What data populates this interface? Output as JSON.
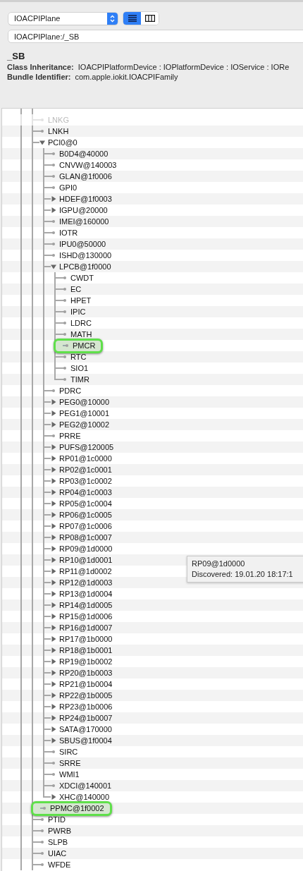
{
  "plane_popup": {
    "value": "IOACPIPlane"
  },
  "view_modes": [
    {
      "kind": "list",
      "selected": true
    },
    {
      "kind": "columns",
      "selected": false
    }
  ],
  "path_field": {
    "value": "IOACPIPlane:/_SB"
  },
  "details": {
    "title": "_SB",
    "rows": [
      {
        "label": "Class Inheritance:",
        "value": "IOACPIPlatformDevice : IOPlatformDevice : IOService : IORe"
      },
      {
        "label": "Bundle Identifier:",
        "value": "com.apple.iokit.IOACPIFamily"
      }
    ]
  },
  "tree": {
    "items": [
      {
        "name": "LNKG",
        "kind": "leaf",
        "highlighted": false,
        "faded": true
      },
      {
        "name": "LNKH",
        "kind": "leaf",
        "highlighted": false,
        "faded": false
      },
      {
        "name": "PCI0@0",
        "kind": "node",
        "expanded": true,
        "highlighted": false,
        "faded": false,
        "children": [
          {
            "name": "B0D4@40000",
            "kind": "leaf",
            "highlighted": false,
            "faded": false
          },
          {
            "name": "CNVW@140003",
            "kind": "leaf",
            "highlighted": false,
            "faded": false
          },
          {
            "name": "GLAN@1f0006",
            "kind": "leaf",
            "highlighted": false,
            "faded": false
          },
          {
            "name": "GPI0",
            "kind": "leaf",
            "highlighted": false,
            "faded": false
          },
          {
            "name": "HDEF@1f0003",
            "kind": "node",
            "expanded": false,
            "highlighted": false,
            "faded": false
          },
          {
            "name": "IGPU@20000",
            "kind": "node",
            "expanded": false,
            "highlighted": false,
            "faded": false
          },
          {
            "name": "IMEI@160000",
            "kind": "leaf",
            "highlighted": false,
            "faded": false
          },
          {
            "name": "IOTR",
            "kind": "leaf",
            "highlighted": false,
            "faded": false
          },
          {
            "name": "IPU0@50000",
            "kind": "leaf",
            "highlighted": false,
            "faded": false
          },
          {
            "name": "ISHD@130000",
            "kind": "leaf",
            "highlighted": false,
            "faded": false
          },
          {
            "name": "LPCB@1f0000",
            "kind": "node",
            "expanded": true,
            "highlighted": false,
            "faded": false,
            "children": [
              {
                "name": "CWDT",
                "kind": "leaf",
                "highlighted": false,
                "faded": false
              },
              {
                "name": "EC",
                "kind": "leaf",
                "highlighted": false,
                "faded": false
              },
              {
                "name": "HPET",
                "kind": "leaf",
                "highlighted": false,
                "faded": false
              },
              {
                "name": "IPIC",
                "kind": "leaf",
                "highlighted": false,
                "faded": false
              },
              {
                "name": "LDRC",
                "kind": "leaf",
                "highlighted": false,
                "faded": false
              },
              {
                "name": "MATH",
                "kind": "leaf",
                "highlighted": false,
                "faded": false
              },
              {
                "name": "PMCR",
                "kind": "leaf",
                "highlighted": true,
                "faded": false
              },
              {
                "name": "RTC",
                "kind": "leaf",
                "highlighted": false,
                "faded": false
              },
              {
                "name": "SIO1",
                "kind": "leaf",
                "highlighted": false,
                "faded": false
              },
              {
                "name": "TIMR",
                "kind": "leaf",
                "highlighted": false,
                "faded": false
              }
            ]
          },
          {
            "name": "PDRC",
            "kind": "leaf",
            "highlighted": false,
            "faded": false
          },
          {
            "name": "PEG0@10000",
            "kind": "node",
            "expanded": false,
            "highlighted": false,
            "faded": false
          },
          {
            "name": "PEG1@10001",
            "kind": "node",
            "expanded": false,
            "highlighted": false,
            "faded": false
          },
          {
            "name": "PEG2@10002",
            "kind": "node",
            "expanded": false,
            "highlighted": false,
            "faded": false
          },
          {
            "name": "PRRE",
            "kind": "leaf",
            "highlighted": false,
            "faded": false
          },
          {
            "name": "PUFS@120005",
            "kind": "node",
            "expanded": false,
            "highlighted": false,
            "faded": false
          },
          {
            "name": "RP01@1c0000",
            "kind": "node",
            "expanded": false,
            "highlighted": false,
            "faded": false
          },
          {
            "name": "RP02@1c0001",
            "kind": "node",
            "expanded": false,
            "highlighted": false,
            "faded": false
          },
          {
            "name": "RP03@1c0002",
            "kind": "node",
            "expanded": false,
            "highlighted": false,
            "faded": false
          },
          {
            "name": "RP04@1c0003",
            "kind": "node",
            "expanded": false,
            "highlighted": false,
            "faded": false
          },
          {
            "name": "RP05@1c0004",
            "kind": "node",
            "expanded": false,
            "highlighted": false,
            "faded": false
          },
          {
            "name": "RP06@1c0005",
            "kind": "node",
            "expanded": false,
            "highlighted": false,
            "faded": false
          },
          {
            "name": "RP07@1c0006",
            "kind": "node",
            "expanded": false,
            "highlighted": false,
            "faded": false
          },
          {
            "name": "RP08@1c0007",
            "kind": "node",
            "expanded": false,
            "highlighted": false,
            "faded": false
          },
          {
            "name": "RP09@1d0000",
            "kind": "node",
            "expanded": false,
            "highlighted": false,
            "faded": false
          },
          {
            "name": "RP10@1d0001",
            "kind": "node",
            "expanded": false,
            "highlighted": false,
            "faded": false
          },
          {
            "name": "RP11@1d0002",
            "kind": "node",
            "expanded": false,
            "highlighted": false,
            "faded": false
          },
          {
            "name": "RP12@1d0003",
            "kind": "node",
            "expanded": false,
            "highlighted": false,
            "faded": false
          },
          {
            "name": "RP13@1d0004",
            "kind": "node",
            "expanded": false,
            "highlighted": false,
            "faded": false
          },
          {
            "name": "RP14@1d0005",
            "kind": "node",
            "expanded": false,
            "highlighted": false,
            "faded": false
          },
          {
            "name": "RP15@1d0006",
            "kind": "node",
            "expanded": false,
            "highlighted": false,
            "faded": false
          },
          {
            "name": "RP16@1d0007",
            "kind": "node",
            "expanded": false,
            "highlighted": false,
            "faded": false
          },
          {
            "name": "RP17@1b0000",
            "kind": "node",
            "expanded": false,
            "highlighted": false,
            "faded": false
          },
          {
            "name": "RP18@1b0001",
            "kind": "node",
            "expanded": false,
            "highlighted": false,
            "faded": false
          },
          {
            "name": "RP19@1b0002",
            "kind": "node",
            "expanded": false,
            "highlighted": false,
            "faded": false
          },
          {
            "name": "RP20@1b0003",
            "kind": "node",
            "expanded": false,
            "highlighted": false,
            "faded": false
          },
          {
            "name": "RP21@1b0004",
            "kind": "node",
            "expanded": false,
            "highlighted": false,
            "faded": false
          },
          {
            "name": "RP22@1b0005",
            "kind": "node",
            "expanded": false,
            "highlighted": false,
            "faded": false
          },
          {
            "name": "RP23@1b0006",
            "kind": "node",
            "expanded": false,
            "highlighted": false,
            "faded": false
          },
          {
            "name": "RP24@1b0007",
            "kind": "node",
            "expanded": false,
            "highlighted": false,
            "faded": false
          },
          {
            "name": "SATA@170000",
            "kind": "node",
            "expanded": false,
            "highlighted": false,
            "faded": false
          },
          {
            "name": "SBUS@1f0004",
            "kind": "node",
            "expanded": false,
            "highlighted": false,
            "faded": false
          },
          {
            "name": "SIRC",
            "kind": "leaf",
            "highlighted": false,
            "faded": false
          },
          {
            "name": "SRRE",
            "kind": "leaf",
            "highlighted": false,
            "faded": false
          },
          {
            "name": "WMI1",
            "kind": "leaf",
            "highlighted": false,
            "faded": false
          },
          {
            "name": "XDCI@140001",
            "kind": "leaf",
            "highlighted": false,
            "faded": false
          },
          {
            "name": "XHC@140000",
            "kind": "node",
            "expanded": false,
            "highlighted": false,
            "faded": false
          }
        ]
      },
      {
        "name": "PPMC@1f0002",
        "kind": "leaf",
        "highlighted": true,
        "faded": false
      },
      {
        "name": "PTID",
        "kind": "leaf",
        "highlighted": false,
        "faded": false
      },
      {
        "name": "PWRB",
        "kind": "leaf",
        "highlighted": false,
        "faded": false
      },
      {
        "name": "SLPB",
        "kind": "leaf",
        "highlighted": false,
        "faded": false
      },
      {
        "name": "UIAC",
        "kind": "leaf",
        "highlighted": false,
        "faded": false
      },
      {
        "name": "WFDE",
        "kind": "leaf",
        "highlighted": false,
        "faded": false
      }
    ]
  },
  "tooltip": {
    "lines": [
      "RP09@1d0000",
      "Discovered: 19.01.20 18:17:1"
    ]
  }
}
